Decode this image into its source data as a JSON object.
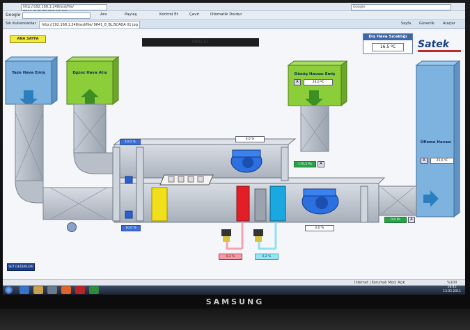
{
  "browser": {
    "address": "http://192.168.1.248/ssd/file/ 9641_8_BL/SCADA 01.jpg",
    "tab_title": "http://192.168.1.248/ssd/file/ 9641_8_BL/SCADA 01.jpg",
    "google_label": "Google",
    "search_placeholder": "Google",
    "toolbar_buttons": [
      "Ara",
      "Paylaş",
      "Kontrol Et",
      "Çevir",
      "Otomatik Doldur"
    ],
    "favorites_label": "Sık Kullanılanlar",
    "command_buttons": [
      "Sayfa",
      "Güvenlik",
      "Araçlar"
    ]
  },
  "scada": {
    "home_button": "ANA SAYFA",
    "title_bar": "MNG-01",
    "outdoor_temp_title": "Dış Hava Sıcaklığı",
    "outdoor_temp_value": "16,5 ºC",
    "logo": "Satek",
    "fresh_air_label": "Taze Hava Emiş",
    "exhaust_label": "Egzoz Hava Atış",
    "return_air_label": "Dönüş Havası Emiş",
    "return_air_value": "26,0 ºC",
    "supply_air_label": "Üfleme Havası",
    "supply_air_value": "25,6 ºC",
    "damper_top_value": "10,0 %",
    "damper_mid_value": "0,0 %",
    "damper_bottom_value": "10,0 %",
    "return_fan_pressure": "170,5 Pa",
    "supply_fan_pressure": "0,0 %",
    "filter_value": "0,0 Pa",
    "heating_valve": "0,2 %",
    "cooling_valve": "0,2 %",
    "set_button": "SET DEĞERLERİ",
    "a_icon": "A"
  },
  "status": {
    "zone": "Internet | Korumalı Mod: Açık",
    "zoom": "%100"
  },
  "taskbar": {
    "time": "16:45",
    "date": "13.05.2011"
  },
  "monitor": {
    "brand": "SAMSUNG"
  },
  "colors": {
    "fresh_air_box": "#7db3de",
    "exhaust_box": "#8ccd3a",
    "return_box": "#8ccd3a",
    "supply_box": "#7db3de",
    "heater": "#e21f26",
    "cooler": "#19a8e0",
    "fan": "#2b6fe0"
  }
}
